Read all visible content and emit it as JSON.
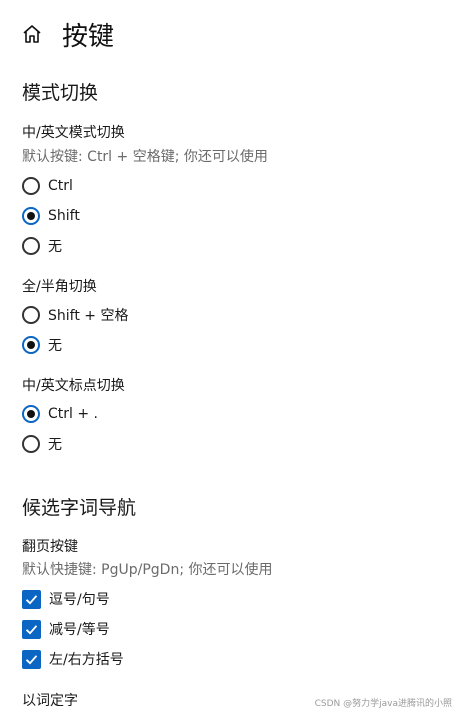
{
  "header": {
    "title": "按键"
  },
  "sections": {
    "mode_switch": {
      "title": "模式切换",
      "cn_en_mode": {
        "title": "中/英文模式切换",
        "hint": "默认按键: Ctrl + 空格键; 你还可以使用",
        "options": [
          "Ctrl",
          "Shift",
          "无"
        ],
        "selected": "Shift"
      },
      "full_half": {
        "title": "全/半角切换",
        "options": [
          "Shift + 空格",
          "无"
        ],
        "selected": "无"
      },
      "punctuation": {
        "title": "中/英文标点切换",
        "options": [
          "Ctrl + .",
          "无"
        ],
        "selected": "Ctrl + ."
      }
    },
    "candidate_nav": {
      "title": "候选字词导航",
      "paging": {
        "title": "翻页按键",
        "hint": "默认快捷键: PgUp/PgDn; 你还可以使用",
        "checkboxes": [
          {
            "label": "逗号/句号",
            "checked": true
          },
          {
            "label": "减号/等号",
            "checked": true
          },
          {
            "label": "左/右方括号",
            "checked": true
          }
        ]
      },
      "select_by_word": {
        "title": "以词定字"
      }
    }
  },
  "watermark": "CSDN @努力学java进腾讯的小照",
  "colors": {
    "accent": "#0a66c2",
    "text": "#1a1a1a",
    "hint": "#6b6b6b"
  }
}
